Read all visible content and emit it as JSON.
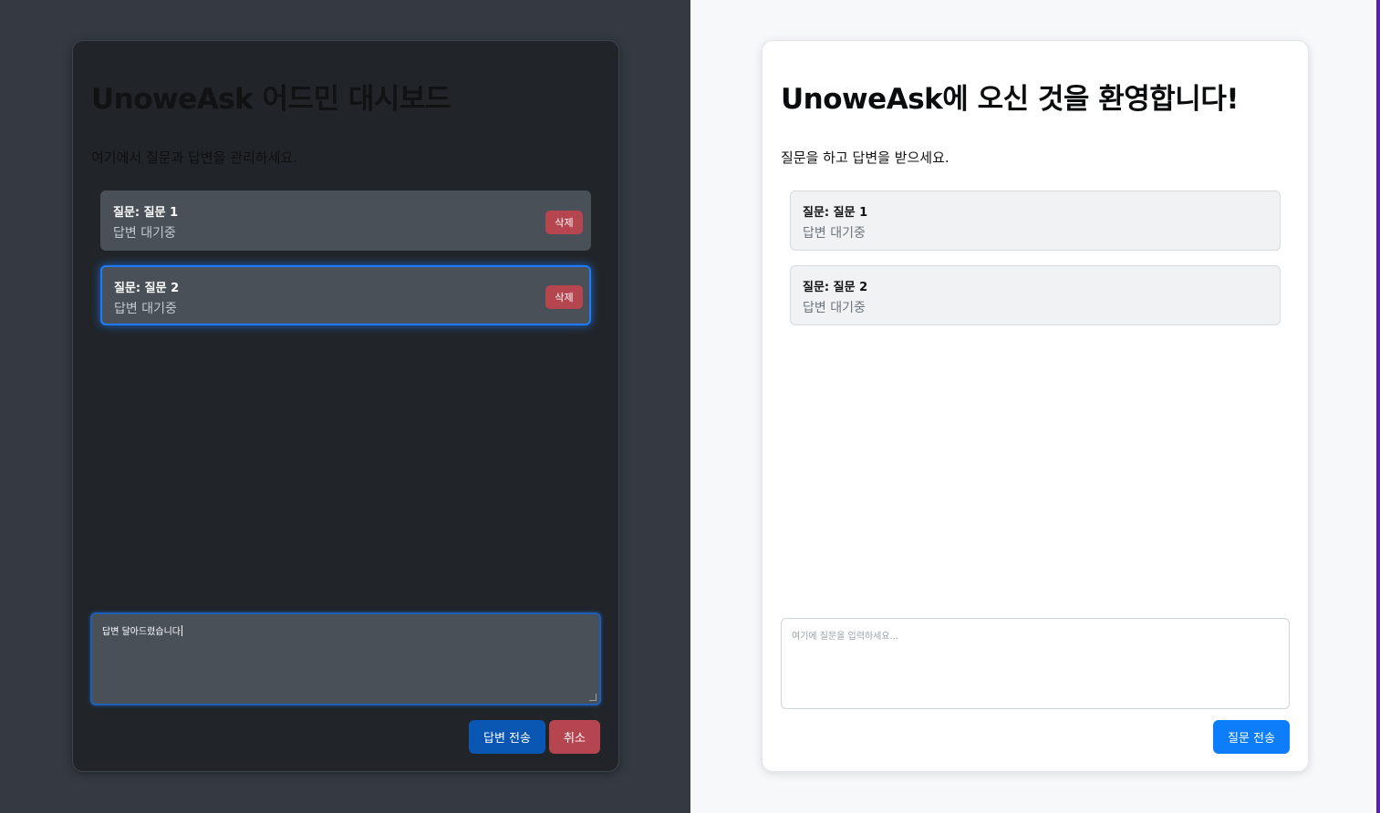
{
  "admin": {
    "title": "UnoweAsk 어드민 대시보드",
    "subtitle": "여기에서 질문과 답변을 관리하세요.",
    "questions": [
      {
        "title": "질문: 질문 1",
        "status": "답변 대기중",
        "delete_label": "삭제"
      },
      {
        "title": "질문: 질문 2",
        "status": "답변 대기중",
        "delete_label": "삭제"
      }
    ],
    "answer_input_value": "답변 달아드렸습니다",
    "submit_label": "답변 전송",
    "cancel_label": "취소"
  },
  "user": {
    "title": "UnoweAsk에 오신 것을 환영합니다!",
    "subtitle": "질문을 하고 답변을 받으세요.",
    "questions": [
      {
        "title": "질문: 질문 1",
        "status": "답변 대기중"
      },
      {
        "title": "질문: 질문 2",
        "status": "답변 대기중"
      }
    ],
    "question_input_placeholder": "여기에 질문을 입력하세요...",
    "submit_label": "질문 전송"
  },
  "colors": {
    "admin_bg": "#343a40",
    "admin_card": "#212529",
    "item_dark": "#495057",
    "selected_outline": "#1e7bff",
    "danger": "#b5454f",
    "primary": "#0d7dfa",
    "primary_dark": "#0a56b3"
  }
}
